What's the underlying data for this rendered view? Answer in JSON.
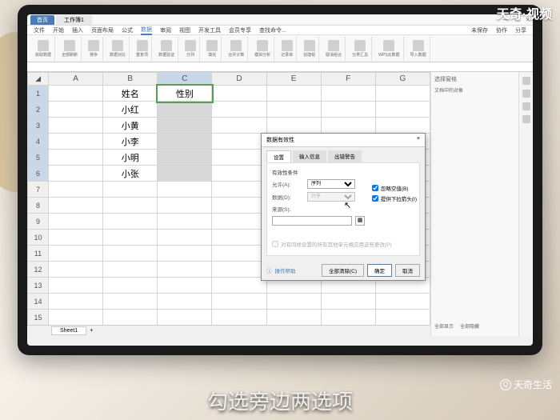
{
  "watermarks": {
    "top_right": "天奇·视频",
    "bottom_right": "天奇生活"
  },
  "subtitle": "勾选旁边两选项",
  "window": {
    "tabs": {
      "home": "首页",
      "doc": "工作簿1"
    },
    "menu": [
      "文件",
      "开始",
      "插入",
      "页面布局",
      "公式",
      "数据",
      "审阅",
      "视图",
      "开发工具",
      "会员专享",
      "查找命令..."
    ],
    "menu_active": "数据",
    "top_right": [
      "未保存",
      "协作",
      "分享"
    ]
  },
  "ribbon": [
    {
      "label": "获取数据"
    },
    {
      "label": "全部刷新"
    },
    {
      "label": "排序"
    },
    {
      "label": "数据对比"
    },
    {
      "label": "重复项"
    },
    {
      "label": "数据验证"
    },
    {
      "label": "分列"
    },
    {
      "label": "填充"
    },
    {
      "label": "合并计算"
    },
    {
      "label": "模拟分析"
    },
    {
      "label": "记录单"
    },
    {
      "label": "创建组"
    },
    {
      "label": "取消组合"
    },
    {
      "label": "分类汇总"
    },
    {
      "label": "WPS云数据"
    },
    {
      "label": "导入数据"
    }
  ],
  "columns": [
    "A",
    "B",
    "C",
    "D",
    "E",
    "F",
    "G"
  ],
  "rows": [
    1,
    2,
    3,
    4,
    5,
    6,
    7,
    8,
    9,
    10,
    11,
    12,
    13,
    14,
    15
  ],
  "cells": {
    "B1": "姓名",
    "C1": "性别",
    "B2": "小红",
    "B3": "小黄",
    "B4": "小李",
    "B5": "小明",
    "B6": "小张"
  },
  "selection": {
    "col": "C",
    "rows": [
      1,
      2,
      3,
      4,
      5,
      6
    ],
    "active": "C1"
  },
  "task_pane": {
    "title": "选择窗格",
    "body": "文档中的对象",
    "footer1": "全部显示",
    "footer2": "全部隐藏"
  },
  "dialog": {
    "title": "数据有效性",
    "close": "×",
    "tabs": [
      "设置",
      "输入信息",
      "出错警告"
    ],
    "section": "有效性条件",
    "allow_label": "允许(A):",
    "allow_value": "序列",
    "data_label": "数据(D):",
    "data_value": "介于",
    "source_label": "来源(S):",
    "source_value": "",
    "chk1": "忽略空值(B)",
    "chk2": "提供下拉箭头(I)",
    "apply_same": "对有同样设置的所有其他单元格应用这些更改(P)",
    "help": "操作帮助",
    "btn_clear": "全部清除(C)",
    "btn_ok": "确定",
    "btn_cancel": "取消"
  },
  "sheet_tab": "Sheet1"
}
